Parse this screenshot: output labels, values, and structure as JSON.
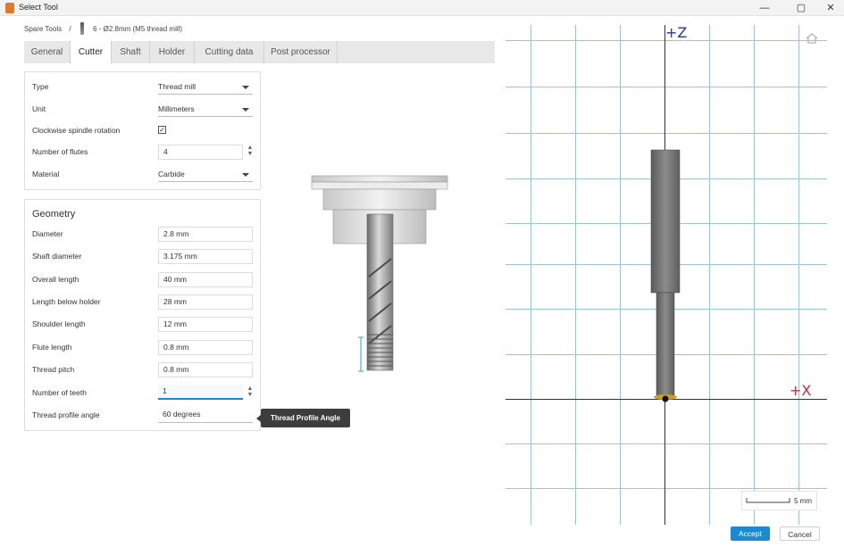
{
  "window": {
    "title": "Select Tool",
    "controls": {
      "minimize": "—",
      "maximize": "▢",
      "close": "✕"
    }
  },
  "breadcrumb": {
    "root": "Spare Tools",
    "separator": "/",
    "current": "6 - Ø2.8mm (M5 thread mill)"
  },
  "tabs": [
    "General",
    "Cutter",
    "Shaft",
    "Holder",
    "Cutting data",
    "Post processor"
  ],
  "active_tab": "Cutter",
  "cutter": {
    "type_label": "Type",
    "type_value": "Thread mill",
    "unit_label": "Unit",
    "unit_value": "Millimeters",
    "cw_label": "Clockwise spindle rotation",
    "cw_checked": "✓",
    "flutes_label": "Number of flutes",
    "flutes_value": "4",
    "material_label": "Material",
    "material_value": "Carbide"
  },
  "geometry": {
    "title": "Geometry",
    "rows": [
      {
        "label": "Diameter",
        "value": "2.8 mm"
      },
      {
        "label": "Shaft diameter",
        "value": "3.175 mm"
      },
      {
        "label": "Overall length",
        "value": "40 mm"
      },
      {
        "label": "Length below holder",
        "value": "28 mm"
      },
      {
        "label": "Shoulder length",
        "value": "12 mm"
      },
      {
        "label": "Flute length",
        "value": "0.8 mm"
      },
      {
        "label": "Thread pitch",
        "value": "0.8 mm"
      },
      {
        "label": "Number of teeth",
        "value": "1"
      },
      {
        "label": "Thread profile angle",
        "value": "60 degrees"
      }
    ]
  },
  "tooltip": "Thread Profile Angle",
  "viewport": {
    "z_label": "+Z",
    "x_label": "+X",
    "scale_label": "5 mm",
    "z_color": "#1f3a93",
    "x_color": "#d6263b"
  },
  "footer": {
    "accept": "Accept",
    "cancel": "Cancel",
    "accent": "#1a8ad4"
  }
}
